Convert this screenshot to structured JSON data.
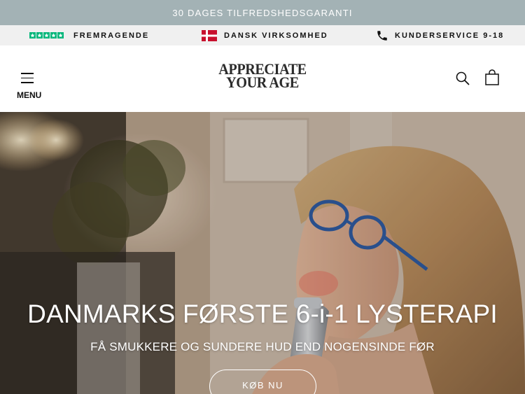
{
  "announcement": {
    "text": "30 DAGES TILFREDSHEDSGARANTI"
  },
  "trust_bar": {
    "items": [
      {
        "icon": "trustpilot-stars-icon",
        "label": "FREMRAGENDE"
      },
      {
        "icon": "danish-flag-icon",
        "label": "DANSK VIRKSOMHED"
      },
      {
        "icon": "phone-icon",
        "label": "KUNDERSERVICE 9-18"
      }
    ]
  },
  "header": {
    "menu_label": "MENU",
    "logo_line1": "APPRECIATE",
    "logo_line2": "YOUR AGE"
  },
  "hero": {
    "title": "DANMARKS FØRSTE 6-i-1 LYSTERAPI",
    "subtitle": "FÅ SMUKKERE OG SUNDERE HUD END NOGENSINDE FØR",
    "cta_label": "KØB NU"
  },
  "colors": {
    "announcement_bg": "#a3b2b5",
    "trustbar_bg": "#f0f0f0",
    "trustpilot_green": "#00b67a",
    "flag_red": "#c8102e"
  }
}
